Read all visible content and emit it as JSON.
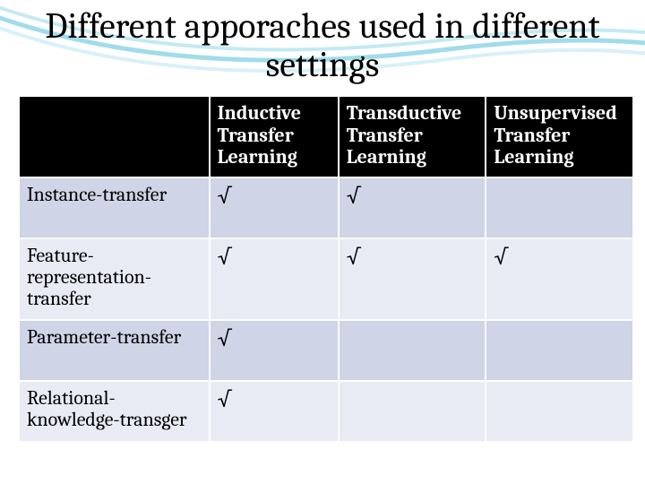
{
  "title": "Different apporaches used in different settings",
  "chart_data": {
    "type": "table",
    "title": "Different apporaches used in different settings",
    "columns": [
      "",
      "Inductive Transfer Learning",
      "Transductive Transfer Learning",
      "Unsupervised Transfer Learning"
    ],
    "rows": [
      {
        "label": "Instance-transfer",
        "cells": [
          "√",
          "√",
          ""
        ]
      },
      {
        "label": "Feature-representation-transfer",
        "cells": [
          "√",
          "√",
          "√"
        ]
      },
      {
        "label": "Parameter-transfer",
        "cells": [
          "√",
          "",
          ""
        ]
      },
      {
        "label": "Relational-knowledge-transger",
        "cells": [
          "√",
          "",
          ""
        ]
      }
    ]
  },
  "table": {
    "headers": {
      "blank": "",
      "col1": "Inductive Transfer Learning",
      "col2": "Transductive Transfer Learning",
      "col3": "Unsupervised Transfer Learning"
    },
    "rows": [
      {
        "label": "Instance-transfer",
        "c1": "√",
        "c2": "√",
        "c3": ""
      },
      {
        "label": "Feature-representation-transfer",
        "c1": "√",
        "c2": "√",
        "c3": "√"
      },
      {
        "label": "Parameter-transfer",
        "c1": "√",
        "c2": "",
        "c3": ""
      },
      {
        "label": "Relational-knowledge-transger",
        "c1": "√",
        "c2": "",
        "c3": ""
      }
    ]
  }
}
